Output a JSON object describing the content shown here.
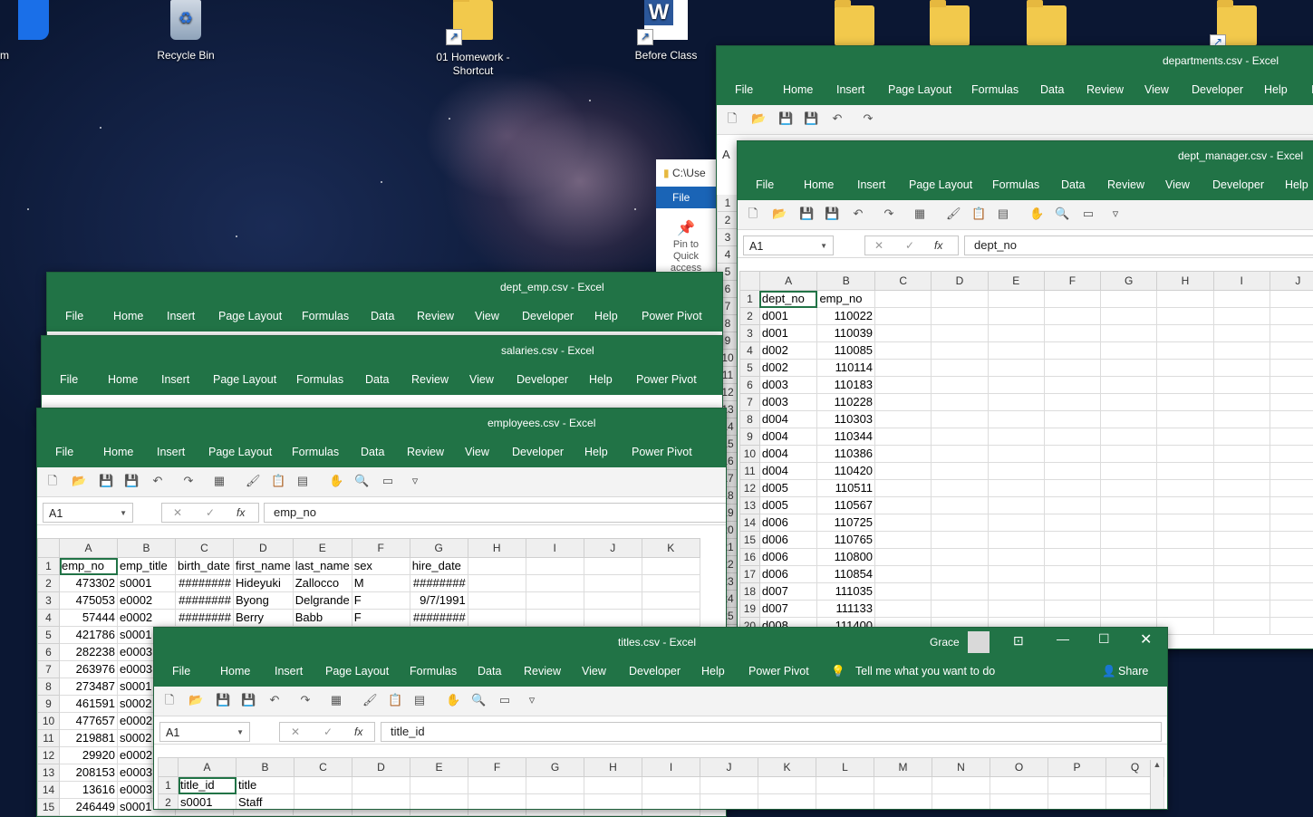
{
  "desktop": {
    "icons": [
      {
        "label": "m"
      },
      {
        "label": "Recycle Bin"
      },
      {
        "label": "01 Homework - Shortcut"
      },
      {
        "label": "Before Class"
      }
    ],
    "explorer_peek": {
      "path": "C:\\Use",
      "file_tab": "File",
      "pin_label": "Pin to Quick access"
    }
  },
  "ribbon_tabs_full": [
    "File",
    "Home",
    "Insert",
    "Page Layout",
    "Formulas",
    "Data",
    "Review",
    "View",
    "Developer",
    "Help",
    "Power Pivot"
  ],
  "windows": {
    "departments": {
      "title": "departments.csv  -  Excel",
      "tabs": [
        "File",
        "Home",
        "Insert",
        "Page Layout",
        "Formulas",
        "Data",
        "Review",
        "View",
        "Developer",
        "Help",
        "I"
      ],
      "namebox_partial": "A",
      "row_numbers": [
        "1",
        "2",
        "3",
        "4",
        "5",
        "6",
        "7",
        "8",
        "9",
        "10",
        "11",
        "12",
        "13",
        "14",
        "15",
        "16",
        "17",
        "18",
        "19",
        "20",
        "21",
        "22",
        "23",
        "24",
        "25"
      ]
    },
    "dept_manager": {
      "title": "dept_manager.csv  -  Excel",
      "tabs": [
        "File",
        "Home",
        "Insert",
        "Page Layout",
        "Formulas",
        "Data",
        "Review",
        "View",
        "Developer",
        "Help"
      ],
      "namebox": "A1",
      "formula": "dept_no",
      "col_headers": [
        "A",
        "B",
        "C",
        "D",
        "E",
        "F",
        "G",
        "H",
        "I",
        "J"
      ],
      "rows": [
        [
          "1",
          "dept_no",
          "emp_no"
        ],
        [
          "2",
          "d001",
          "110022"
        ],
        [
          "3",
          "d001",
          "110039"
        ],
        [
          "4",
          "d002",
          "110085"
        ],
        [
          "5",
          "d002",
          "110114"
        ],
        [
          "6",
          "d003",
          "110183"
        ],
        [
          "7",
          "d003",
          "110228"
        ],
        [
          "8",
          "d004",
          "110303"
        ],
        [
          "9",
          "d004",
          "110344"
        ],
        [
          "10",
          "d004",
          "110386"
        ],
        [
          "11",
          "d004",
          "110420"
        ],
        [
          "12",
          "d005",
          "110511"
        ],
        [
          "13",
          "d005",
          "110567"
        ],
        [
          "14",
          "d006",
          "110725"
        ],
        [
          "15",
          "d006",
          "110765"
        ],
        [
          "16",
          "d006",
          "110800"
        ],
        [
          "17",
          "d006",
          "110854"
        ],
        [
          "18",
          "d007",
          "111035"
        ],
        [
          "19",
          "d007",
          "111133"
        ],
        [
          "20",
          "d008",
          "111400"
        ]
      ]
    },
    "dept_emp": {
      "title": "dept_emp.csv  -  Excel"
    },
    "salaries": {
      "title": "salaries.csv  -  Excel"
    },
    "employees": {
      "title": "employees.csv  -  Excel",
      "namebox": "A1",
      "formula": "emp_no",
      "col_headers": [
        "A",
        "B",
        "C",
        "D",
        "E",
        "F",
        "G",
        "H",
        "I",
        "J",
        "K"
      ],
      "rows": [
        [
          "1",
          "emp_no",
          "emp_title",
          "birth_date",
          "first_name",
          "last_name",
          "sex",
          "hire_date"
        ],
        [
          "2",
          "473302",
          "s0001",
          "########",
          "Hideyuki",
          "Zallocco",
          "M",
          "########"
        ],
        [
          "3",
          "475053",
          "e0002",
          "########",
          "Byong",
          "Delgrande",
          "F",
          "9/7/1991"
        ],
        [
          "4",
          "57444",
          "e0002",
          "########",
          "Berry",
          "Babb",
          "F",
          "########"
        ],
        [
          "5",
          "421786",
          "s0001"
        ],
        [
          "6",
          "282238",
          "e0003"
        ],
        [
          "7",
          "263976",
          "e0003"
        ],
        [
          "8",
          "273487",
          "s0001"
        ],
        [
          "9",
          "461591",
          "s0002"
        ],
        [
          "10",
          "477657",
          "e0002"
        ],
        [
          "11",
          "219881",
          "s0002"
        ],
        [
          "12",
          "29920",
          "e0002"
        ],
        [
          "13",
          "208153",
          "e0003"
        ],
        [
          "14",
          "13616",
          "e0003"
        ],
        [
          "15",
          "246449",
          "s0001"
        ]
      ]
    },
    "titles": {
      "title": "titles.csv  -  Excel",
      "user": "Grace",
      "tabs": [
        "File",
        "Home",
        "Insert",
        "Page Layout",
        "Formulas",
        "Data",
        "Review",
        "View",
        "Developer",
        "Help",
        "Power Pivot"
      ],
      "tell_me": "Tell me what you want to do",
      "share": "Share",
      "namebox": "A1",
      "formula": "title_id",
      "col_headers": [
        "A",
        "B",
        "C",
        "D",
        "E",
        "F",
        "G",
        "H",
        "I",
        "J",
        "K",
        "L",
        "M",
        "N",
        "O",
        "P",
        "Q"
      ],
      "rows": [
        [
          "1",
          "title_id",
          "title"
        ],
        [
          "2",
          "s0001",
          "Staff"
        ]
      ]
    }
  }
}
